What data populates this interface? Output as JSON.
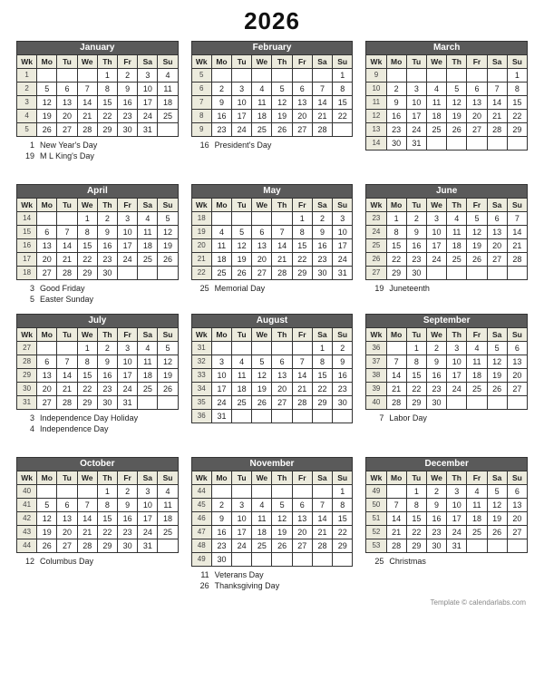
{
  "year": "2026",
  "dow": [
    "Wk",
    "Mo",
    "Tu",
    "We",
    "Th",
    "Fr",
    "Sa",
    "Su"
  ],
  "footer": "Template © calendarlabs.com",
  "months": [
    {
      "name": "January",
      "weeks": [
        {
          "wk": "1",
          "days": [
            "",
            "",
            "",
            "1",
            "2",
            "3",
            "4"
          ]
        },
        {
          "wk": "2",
          "days": [
            "5",
            "6",
            "7",
            "8",
            "9",
            "10",
            "11"
          ]
        },
        {
          "wk": "3",
          "days": [
            "12",
            "13",
            "14",
            "15",
            "16",
            "17",
            "18"
          ]
        },
        {
          "wk": "4",
          "days": [
            "19",
            "20",
            "21",
            "22",
            "23",
            "24",
            "25"
          ]
        },
        {
          "wk": "5",
          "days": [
            "26",
            "27",
            "28",
            "29",
            "30",
            "31",
            ""
          ]
        }
      ],
      "holidays": [
        {
          "d": "1",
          "t": "New Year's Day"
        },
        {
          "d": "19",
          "t": "M L King's Day"
        }
      ]
    },
    {
      "name": "February",
      "weeks": [
        {
          "wk": "5",
          "days": [
            "",
            "",
            "",
            "",
            "",
            "",
            "1"
          ]
        },
        {
          "wk": "6",
          "days": [
            "2",
            "3",
            "4",
            "5",
            "6",
            "7",
            "8"
          ]
        },
        {
          "wk": "7",
          "days": [
            "9",
            "10",
            "11",
            "12",
            "13",
            "14",
            "15"
          ]
        },
        {
          "wk": "8",
          "days": [
            "16",
            "17",
            "18",
            "19",
            "20",
            "21",
            "22"
          ]
        },
        {
          "wk": "9",
          "days": [
            "23",
            "24",
            "25",
            "26",
            "27",
            "28",
            ""
          ]
        }
      ],
      "holidays": [
        {
          "d": "16",
          "t": "President's Day"
        }
      ]
    },
    {
      "name": "March",
      "weeks": [
        {
          "wk": "9",
          "days": [
            "",
            "",
            "",
            "",
            "",
            "",
            "1"
          ]
        },
        {
          "wk": "10",
          "days": [
            "2",
            "3",
            "4",
            "5",
            "6",
            "7",
            "8"
          ]
        },
        {
          "wk": "11",
          "days": [
            "9",
            "10",
            "11",
            "12",
            "13",
            "14",
            "15"
          ]
        },
        {
          "wk": "12",
          "days": [
            "16",
            "17",
            "18",
            "19",
            "20",
            "21",
            "22"
          ]
        },
        {
          "wk": "13",
          "days": [
            "23",
            "24",
            "25",
            "26",
            "27",
            "28",
            "29"
          ]
        },
        {
          "wk": "14",
          "days": [
            "30",
            "31",
            "",
            "",
            "",
            "",
            ""
          ]
        }
      ],
      "holidays": []
    },
    {
      "name": "April",
      "weeks": [
        {
          "wk": "14",
          "days": [
            "",
            "",
            "1",
            "2",
            "3",
            "4",
            "5"
          ]
        },
        {
          "wk": "15",
          "days": [
            "6",
            "7",
            "8",
            "9",
            "10",
            "11",
            "12"
          ]
        },
        {
          "wk": "16",
          "days": [
            "13",
            "14",
            "15",
            "16",
            "17",
            "18",
            "19"
          ]
        },
        {
          "wk": "17",
          "days": [
            "20",
            "21",
            "22",
            "23",
            "24",
            "25",
            "26"
          ]
        },
        {
          "wk": "18",
          "days": [
            "27",
            "28",
            "29",
            "30",
            "",
            "",
            ""
          ]
        }
      ],
      "holidays": [
        {
          "d": "3",
          "t": "Good Friday"
        },
        {
          "d": "5",
          "t": "Easter Sunday"
        }
      ]
    },
    {
      "name": "May",
      "weeks": [
        {
          "wk": "18",
          "days": [
            "",
            "",
            "",
            "",
            "1",
            "2",
            "3"
          ]
        },
        {
          "wk": "19",
          "days": [
            "4",
            "5",
            "6",
            "7",
            "8",
            "9",
            "10"
          ]
        },
        {
          "wk": "20",
          "days": [
            "11",
            "12",
            "13",
            "14",
            "15",
            "16",
            "17"
          ]
        },
        {
          "wk": "21",
          "days": [
            "18",
            "19",
            "20",
            "21",
            "22",
            "23",
            "24"
          ]
        },
        {
          "wk": "22",
          "days": [
            "25",
            "26",
            "27",
            "28",
            "29",
            "30",
            "31"
          ]
        }
      ],
      "holidays": [
        {
          "d": "25",
          "t": "Memorial Day"
        }
      ]
    },
    {
      "name": "June",
      "weeks": [
        {
          "wk": "23",
          "days": [
            "1",
            "2",
            "3",
            "4",
            "5",
            "6",
            "7"
          ]
        },
        {
          "wk": "24",
          "days": [
            "8",
            "9",
            "10",
            "11",
            "12",
            "13",
            "14"
          ]
        },
        {
          "wk": "25",
          "days": [
            "15",
            "16",
            "17",
            "18",
            "19",
            "20",
            "21"
          ]
        },
        {
          "wk": "26",
          "days": [
            "22",
            "23",
            "24",
            "25",
            "26",
            "27",
            "28"
          ]
        },
        {
          "wk": "27",
          "days": [
            "29",
            "30",
            "",
            "",
            "",
            "",
            ""
          ]
        }
      ],
      "holidays": [
        {
          "d": "19",
          "t": "Juneteenth"
        }
      ]
    },
    {
      "name": "July",
      "weeks": [
        {
          "wk": "27",
          "days": [
            "",
            "",
            "1",
            "2",
            "3",
            "4",
            "5"
          ]
        },
        {
          "wk": "28",
          "days": [
            "6",
            "7",
            "8",
            "9",
            "10",
            "11",
            "12"
          ]
        },
        {
          "wk": "29",
          "days": [
            "13",
            "14",
            "15",
            "16",
            "17",
            "18",
            "19"
          ]
        },
        {
          "wk": "30",
          "days": [
            "20",
            "21",
            "22",
            "23",
            "24",
            "25",
            "26"
          ]
        },
        {
          "wk": "31",
          "days": [
            "27",
            "28",
            "29",
            "30",
            "31",
            "",
            ""
          ]
        }
      ],
      "holidays": [
        {
          "d": "3",
          "t": "Independence Day Holiday"
        },
        {
          "d": "4",
          "t": "Independence Day"
        }
      ]
    },
    {
      "name": "August",
      "weeks": [
        {
          "wk": "31",
          "days": [
            "",
            "",
            "",
            "",
            "",
            "1",
            "2"
          ]
        },
        {
          "wk": "32",
          "days": [
            "3",
            "4",
            "5",
            "6",
            "7",
            "8",
            "9"
          ]
        },
        {
          "wk": "33",
          "days": [
            "10",
            "11",
            "12",
            "13",
            "14",
            "15",
            "16"
          ]
        },
        {
          "wk": "34",
          "days": [
            "17",
            "18",
            "19",
            "20",
            "21",
            "22",
            "23"
          ]
        },
        {
          "wk": "35",
          "days": [
            "24",
            "25",
            "26",
            "27",
            "28",
            "29",
            "30"
          ]
        },
        {
          "wk": "36",
          "days": [
            "31",
            "",
            "",
            "",
            "",
            "",
            ""
          ]
        }
      ],
      "holidays": []
    },
    {
      "name": "September",
      "weeks": [
        {
          "wk": "36",
          "days": [
            "",
            "1",
            "2",
            "3",
            "4",
            "5",
            "6"
          ]
        },
        {
          "wk": "37",
          "days": [
            "7",
            "8",
            "9",
            "10",
            "11",
            "12",
            "13"
          ]
        },
        {
          "wk": "38",
          "days": [
            "14",
            "15",
            "16",
            "17",
            "18",
            "19",
            "20"
          ]
        },
        {
          "wk": "39",
          "days": [
            "21",
            "22",
            "23",
            "24",
            "25",
            "26",
            "27"
          ]
        },
        {
          "wk": "40",
          "days": [
            "28",
            "29",
            "30",
            "",
            "",
            "",
            ""
          ]
        }
      ],
      "holidays": [
        {
          "d": "7",
          "t": "Labor Day"
        }
      ]
    },
    {
      "name": "October",
      "weeks": [
        {
          "wk": "40",
          "days": [
            "",
            "",
            "",
            "1",
            "2",
            "3",
            "4"
          ]
        },
        {
          "wk": "41",
          "days": [
            "5",
            "6",
            "7",
            "8",
            "9",
            "10",
            "11"
          ]
        },
        {
          "wk": "42",
          "days": [
            "12",
            "13",
            "14",
            "15",
            "16",
            "17",
            "18"
          ]
        },
        {
          "wk": "43",
          "days": [
            "19",
            "20",
            "21",
            "22",
            "23",
            "24",
            "25"
          ]
        },
        {
          "wk": "44",
          "days": [
            "26",
            "27",
            "28",
            "29",
            "30",
            "31",
            ""
          ]
        }
      ],
      "holidays": [
        {
          "d": "12",
          "t": "Columbus Day"
        }
      ]
    },
    {
      "name": "November",
      "weeks": [
        {
          "wk": "44",
          "days": [
            "",
            "",
            "",
            "",
            "",
            "",
            "1"
          ]
        },
        {
          "wk": "45",
          "days": [
            "2",
            "3",
            "4",
            "5",
            "6",
            "7",
            "8"
          ]
        },
        {
          "wk": "46",
          "days": [
            "9",
            "10",
            "11",
            "12",
            "13",
            "14",
            "15"
          ]
        },
        {
          "wk": "47",
          "days": [
            "16",
            "17",
            "18",
            "19",
            "20",
            "21",
            "22"
          ]
        },
        {
          "wk": "48",
          "days": [
            "23",
            "24",
            "25",
            "26",
            "27",
            "28",
            "29"
          ]
        },
        {
          "wk": "49",
          "days": [
            "30",
            "",
            "",
            "",
            "",
            "",
            ""
          ]
        }
      ],
      "holidays": [
        {
          "d": "11",
          "t": "Veterans Day"
        },
        {
          "d": "26",
          "t": "Thanksgiving Day"
        }
      ]
    },
    {
      "name": "December",
      "weeks": [
        {
          "wk": "49",
          "days": [
            "",
            "1",
            "2",
            "3",
            "4",
            "5",
            "6"
          ]
        },
        {
          "wk": "50",
          "days": [
            "7",
            "8",
            "9",
            "10",
            "11",
            "12",
            "13"
          ]
        },
        {
          "wk": "51",
          "days": [
            "14",
            "15",
            "16",
            "17",
            "18",
            "19",
            "20"
          ]
        },
        {
          "wk": "52",
          "days": [
            "21",
            "22",
            "23",
            "24",
            "25",
            "26",
            "27"
          ]
        },
        {
          "wk": "53",
          "days": [
            "28",
            "29",
            "30",
            "31",
            "",
            "",
            ""
          ]
        }
      ],
      "holidays": [
        {
          "d": "25",
          "t": "Christmas"
        }
      ]
    }
  ]
}
